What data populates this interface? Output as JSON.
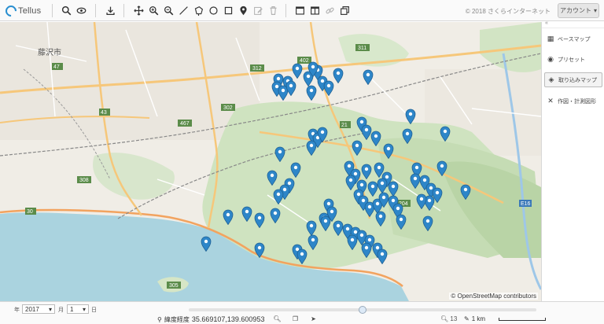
{
  "app": {
    "logo_text": "Tellus"
  },
  "toolbar": {
    "copyright": "© 2018 さくらインターネット",
    "account_label": "アカウント",
    "account_caret": "▾",
    "tools": [
      {
        "name": "search-icon"
      },
      {
        "name": "eye-icon"
      },
      {
        "name": "download-icon"
      },
      {
        "name": "pan-icon"
      },
      {
        "name": "zoom-in-icon"
      },
      {
        "name": "zoom-out-icon"
      },
      {
        "name": "line-draw-icon"
      },
      {
        "name": "polygon-draw-icon"
      },
      {
        "name": "circle-draw-icon"
      },
      {
        "name": "rectangle-draw-icon"
      },
      {
        "name": "marker-icon"
      },
      {
        "name": "edit-icon"
      },
      {
        "name": "trash-icon"
      },
      {
        "name": "layout-single-icon"
      },
      {
        "name": "layout-split-icon"
      },
      {
        "name": "link-icon"
      },
      {
        "name": "layers-copy-icon"
      }
    ]
  },
  "map": {
    "attribution": "© OpenStreetMap contributors",
    "pin_color": "#2e86c8",
    "labels": {
      "city": "藤沢市",
      "routes": [
        "47",
        "402",
        "312",
        "43",
        "302",
        "21",
        "467",
        "308",
        "30",
        "204",
        "311",
        "305",
        "E16"
      ]
    },
    "pin_count": 86
  },
  "sidepanel": {
    "collapse_glyph": "«",
    "items": [
      {
        "label": "ベースマップ",
        "icon": "basemap-icon",
        "glyph": "▦",
        "active": false
      },
      {
        "label": "プリセット",
        "icon": "preset-icon",
        "glyph": "◉",
        "active": false
      },
      {
        "label": "取り込みマップ",
        "icon": "imported-map-icon",
        "glyph": "◈",
        "active": true
      },
      {
        "label": "作図・計測図形",
        "icon": "drawing-tools-icon",
        "glyph": "✕",
        "active": false
      }
    ]
  },
  "bottombar": {
    "year_value": "2017",
    "year_suffix": "年",
    "month_value": "1",
    "month_suffix": "月",
    "day_value": "1",
    "day_suffix": "日",
    "coord_label": "緯度経度",
    "coord_value": "35.669107,139.600953",
    "zoom_label": "13",
    "scale_label": "1 km",
    "slider_position": 0.5
  }
}
